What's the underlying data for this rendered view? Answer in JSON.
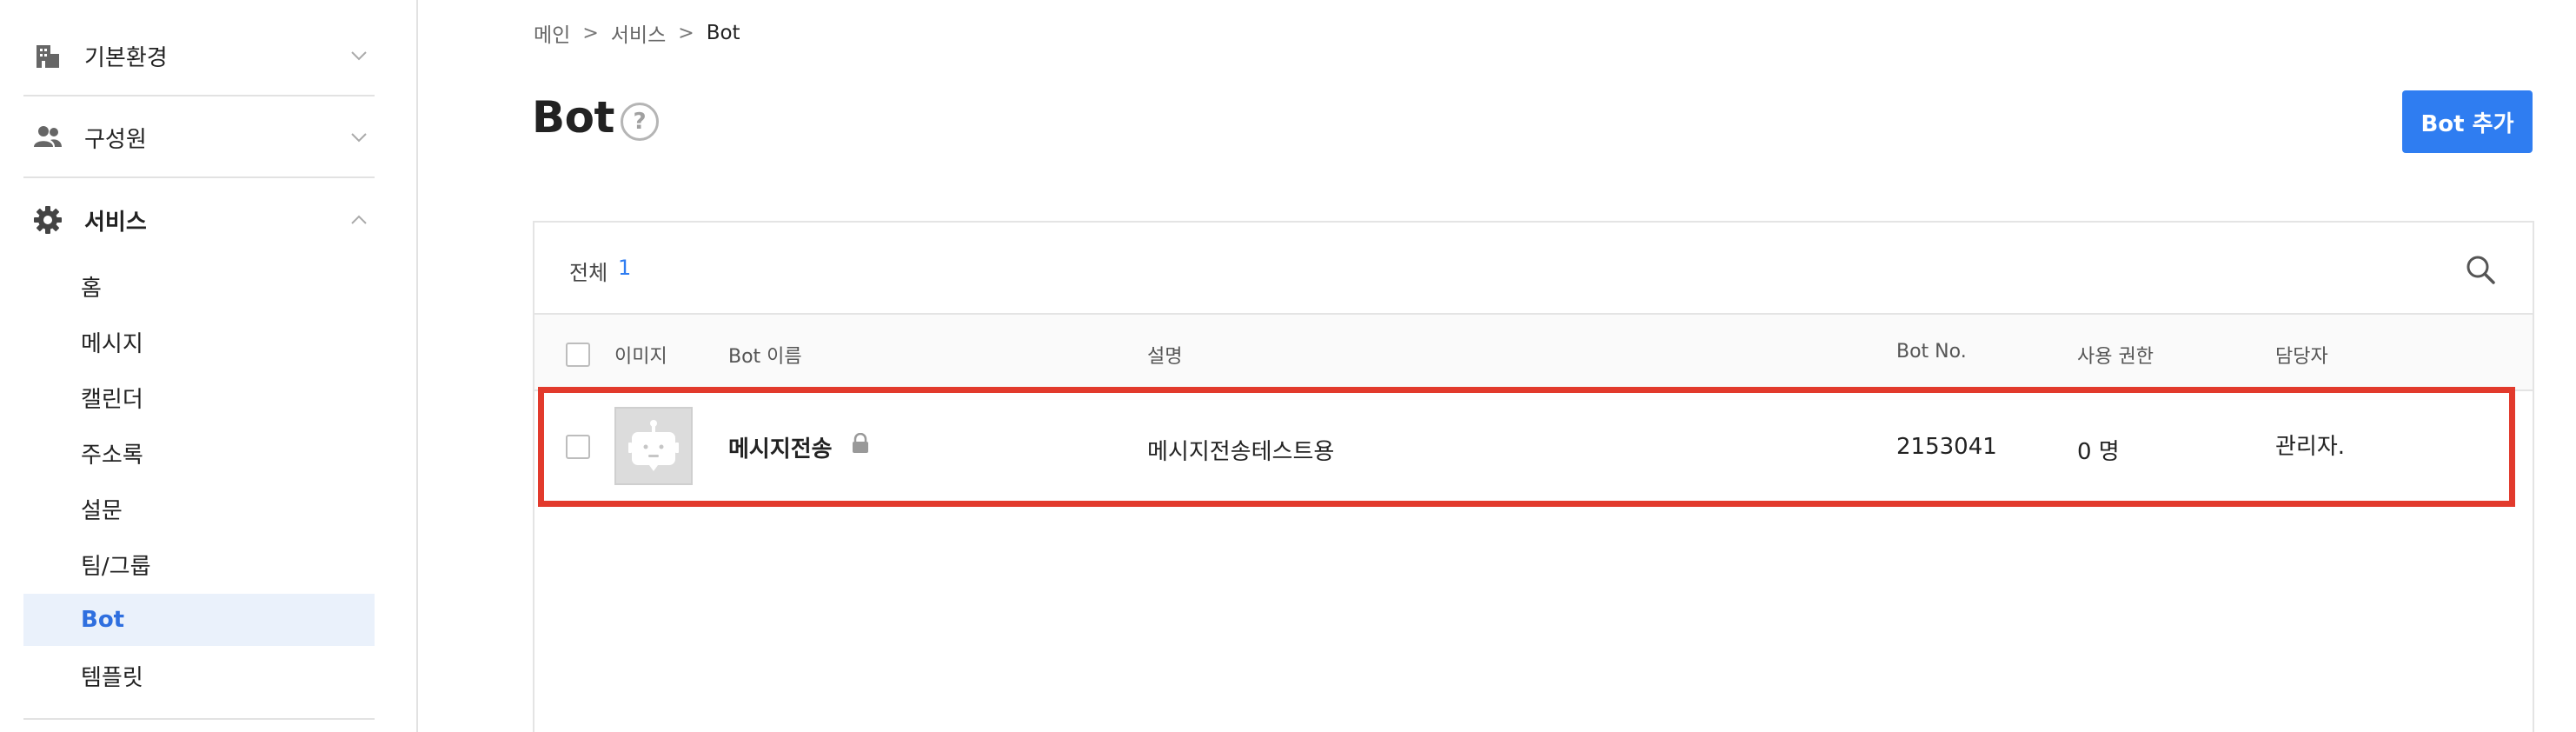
{
  "sidebar": {
    "groups": [
      {
        "label": "기본환경",
        "icon": "building-icon",
        "expanded": false
      },
      {
        "label": "구성원",
        "icon": "people-icon",
        "expanded": false
      },
      {
        "label": "서비스",
        "icon": "gear-icon",
        "expanded": true
      }
    ],
    "service_items": [
      {
        "label": "홈"
      },
      {
        "label": "메시지"
      },
      {
        "label": "캘린더"
      },
      {
        "label": "주소록"
      },
      {
        "label": "설문"
      },
      {
        "label": "팀/그룹"
      },
      {
        "label": "Bot",
        "active": true
      },
      {
        "label": "템플릿"
      }
    ]
  },
  "breadcrumb": {
    "items": [
      "메인",
      "서비스",
      "Bot"
    ]
  },
  "page": {
    "title": "Bot",
    "help_icon": "question-circle-icon",
    "add_button_label": "Bot 추가"
  },
  "table": {
    "total_label": "전체",
    "total_count": "1",
    "columns": {
      "image": "이미지",
      "bot_name": "Bot 이름",
      "description": "설명",
      "bot_no": "Bot No.",
      "permission": "사용 권한",
      "manager": "담당자"
    },
    "rows": [
      {
        "image_icon": "robot-icon",
        "bot_name": "메시지전송",
        "locked": true,
        "description": "메시지전송테스트용",
        "bot_no": "2153041",
        "permission": "0 명",
        "manager": "관리자."
      }
    ]
  },
  "colors": {
    "accent": "#2f7df1",
    "active_nav_bg": "#eaf1fb",
    "active_nav_text": "#2f6fdf",
    "highlight_border": "#e23a2c"
  }
}
